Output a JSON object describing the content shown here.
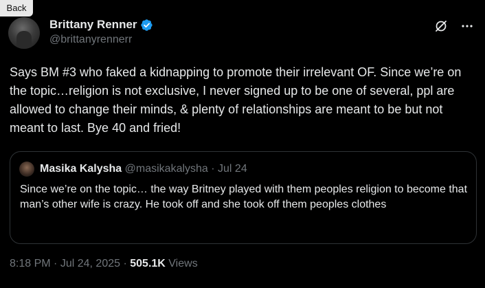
{
  "browser": {
    "back_label": "Back"
  },
  "author": {
    "display_name": "Brittany Renner",
    "handle": "@brittanyrennerr",
    "verified_color": "#1d9bf0"
  },
  "tweet": {
    "text": "Says BM #3 who faked a kidnapping to promote their irrelevant OF. Since we’re on the topic…religion is not exclusive, I never signed up to be one of several, ppl are allowed to change their minds, & plenty of relationships are meant to be but not meant to last. Bye 40 and fried!",
    "time": "8:18 PM",
    "date": "Jul 24, 2025",
    "views_count": "505.1K",
    "views_label": "Views"
  },
  "quote": {
    "display_name": "Masika Kalysha",
    "handle": "@masikakalysha",
    "date": "Jul 24",
    "text": "Since we’re on the topic… the way Britney played with them peoples religion to become that man’s other wife is crazy. He took off and she took off them peoples clothes"
  },
  "icons": {
    "grok": "grok-icon",
    "more": "more-icon",
    "verified": "verified-badge-icon"
  }
}
